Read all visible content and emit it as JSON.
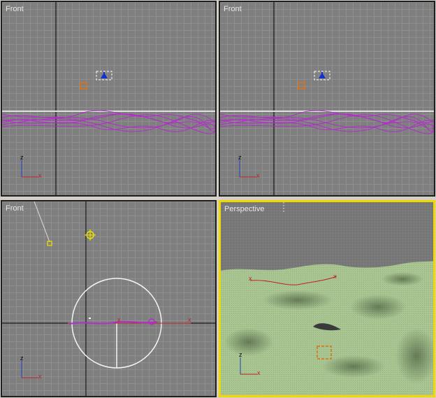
{
  "viewports": {
    "top_left": {
      "label": "Front"
    },
    "top_right": {
      "label": "Front"
    },
    "bottom_left": {
      "label": "Front"
    },
    "bottom_right": {
      "label": "Perspective"
    }
  },
  "axis_labels": {
    "z": "z",
    "x": "x"
  },
  "colors": {
    "spline": "#b030c8",
    "active_border": "#f0d800",
    "axis_x": "#c02020",
    "axis_z": "#2040c0",
    "terrain": "#a8c490",
    "object_marker": "#e07010",
    "light": "#f0e000"
  }
}
